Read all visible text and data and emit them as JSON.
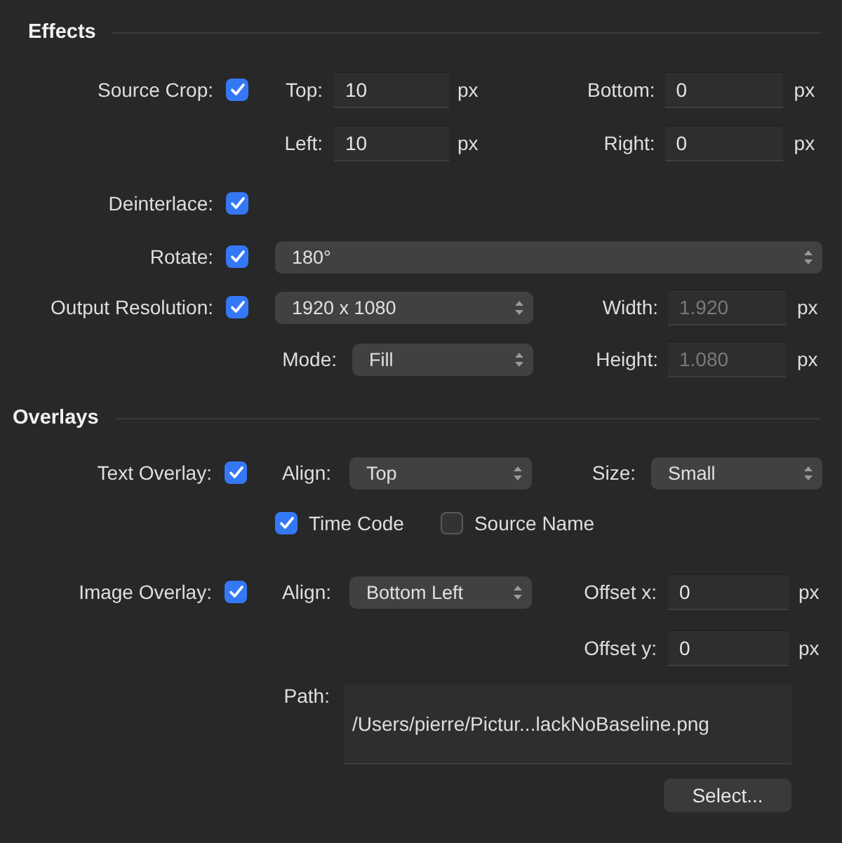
{
  "effects": {
    "title": "Effects",
    "source_crop": {
      "label": "Source Crop:",
      "checked": true,
      "top": {
        "label": "Top:",
        "value": "10",
        "unit": "px"
      },
      "bottom": {
        "label": "Bottom:",
        "value": "0",
        "unit": "px"
      },
      "left": {
        "label": "Left:",
        "value": "10",
        "unit": "px"
      },
      "right": {
        "label": "Right:",
        "value": "0",
        "unit": "px"
      }
    },
    "deinterlace": {
      "label": "Deinterlace:",
      "checked": true
    },
    "rotate": {
      "label": "Rotate:",
      "checked": true,
      "value": "180°"
    },
    "output_resolution": {
      "label": "Output Resolution:",
      "checked": true,
      "preset": "1920 x 1080",
      "width": {
        "label": "Width:",
        "value": "1.920",
        "unit": "px",
        "disabled": true
      },
      "mode": {
        "label": "Mode:",
        "value": "Fill"
      },
      "height": {
        "label": "Height:",
        "value": "1.080",
        "unit": "px",
        "disabled": true
      }
    }
  },
  "overlays": {
    "title": "Overlays",
    "text_overlay": {
      "label": "Text Overlay:",
      "checked": true,
      "align": {
        "label": "Align:",
        "value": "Top"
      },
      "size": {
        "label": "Size:",
        "value": "Small"
      },
      "options": [
        {
          "label": "Time Code",
          "checked": true
        },
        {
          "label": "Source Name",
          "checked": false
        }
      ]
    },
    "image_overlay": {
      "label": "Image Overlay:",
      "checked": true,
      "align": {
        "label": "Align:",
        "value": "Bottom Left"
      },
      "offset_x": {
        "label": "Offset x:",
        "value": "0",
        "unit": "px"
      },
      "offset_y": {
        "label": "Offset y:",
        "value": "0",
        "unit": "px"
      },
      "path": {
        "label": "Path:",
        "value": "/Users/pierre/Pictur...lackNoBaseline.png"
      },
      "select_button": "Select..."
    }
  }
}
